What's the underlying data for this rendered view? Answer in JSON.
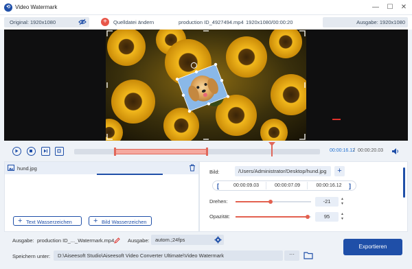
{
  "window": {
    "title": "Video Watermark",
    "controls": {
      "minimize": "—",
      "maximize": "☐",
      "close": "✕"
    }
  },
  "infobar": {
    "original_label": "Original: 1920x1080",
    "add_source_label": "Quelldatei ändern",
    "file_name": "production ID_4927494.mp4",
    "file_resolution_duration": "1920x1080/00:00:20",
    "output_label": "Ausgabe: 1920x1080"
  },
  "playback": {
    "current_time": "00:00:16.12",
    "separator": "/",
    "total_time": "00:00:20.03"
  },
  "watermark_list": {
    "items": [
      {
        "name": "hund.jpg"
      }
    ],
    "add_text_label": "Text Wasserzeichen",
    "add_image_label": "Bild Wasserzeichen"
  },
  "settings": {
    "image_label": "Bild:",
    "image_path": "/Users/Administrator/Desktop/hund.jpg",
    "time_start": "00:00:09.03",
    "time_duration": "00:00:07.09",
    "time_end": "00:00:16.12",
    "rotate_label": "Drehen:",
    "rotate_value": "-21",
    "rotate_level": 0.46,
    "opacity_label": "Opazität:",
    "opacity_value": "95",
    "opacity_level": 0.95
  },
  "bottom": {
    "output_label": "Ausgabe:",
    "output_file": "production ID_..._Watermark.mp4",
    "format_label": "Ausgabe:",
    "format_value": "autom.;24fps",
    "save_label": "Speichern unter:",
    "save_path": "D:\\Aiseesoft Studio\\Aiseesoft Video Converter Ultimate\\Video Watermark",
    "more_label": "···",
    "export_label": "Exportieren"
  },
  "colors": {
    "accent": "#1f4fa8",
    "timeline_range": "#f5a99f",
    "slider": "#e3604f"
  }
}
